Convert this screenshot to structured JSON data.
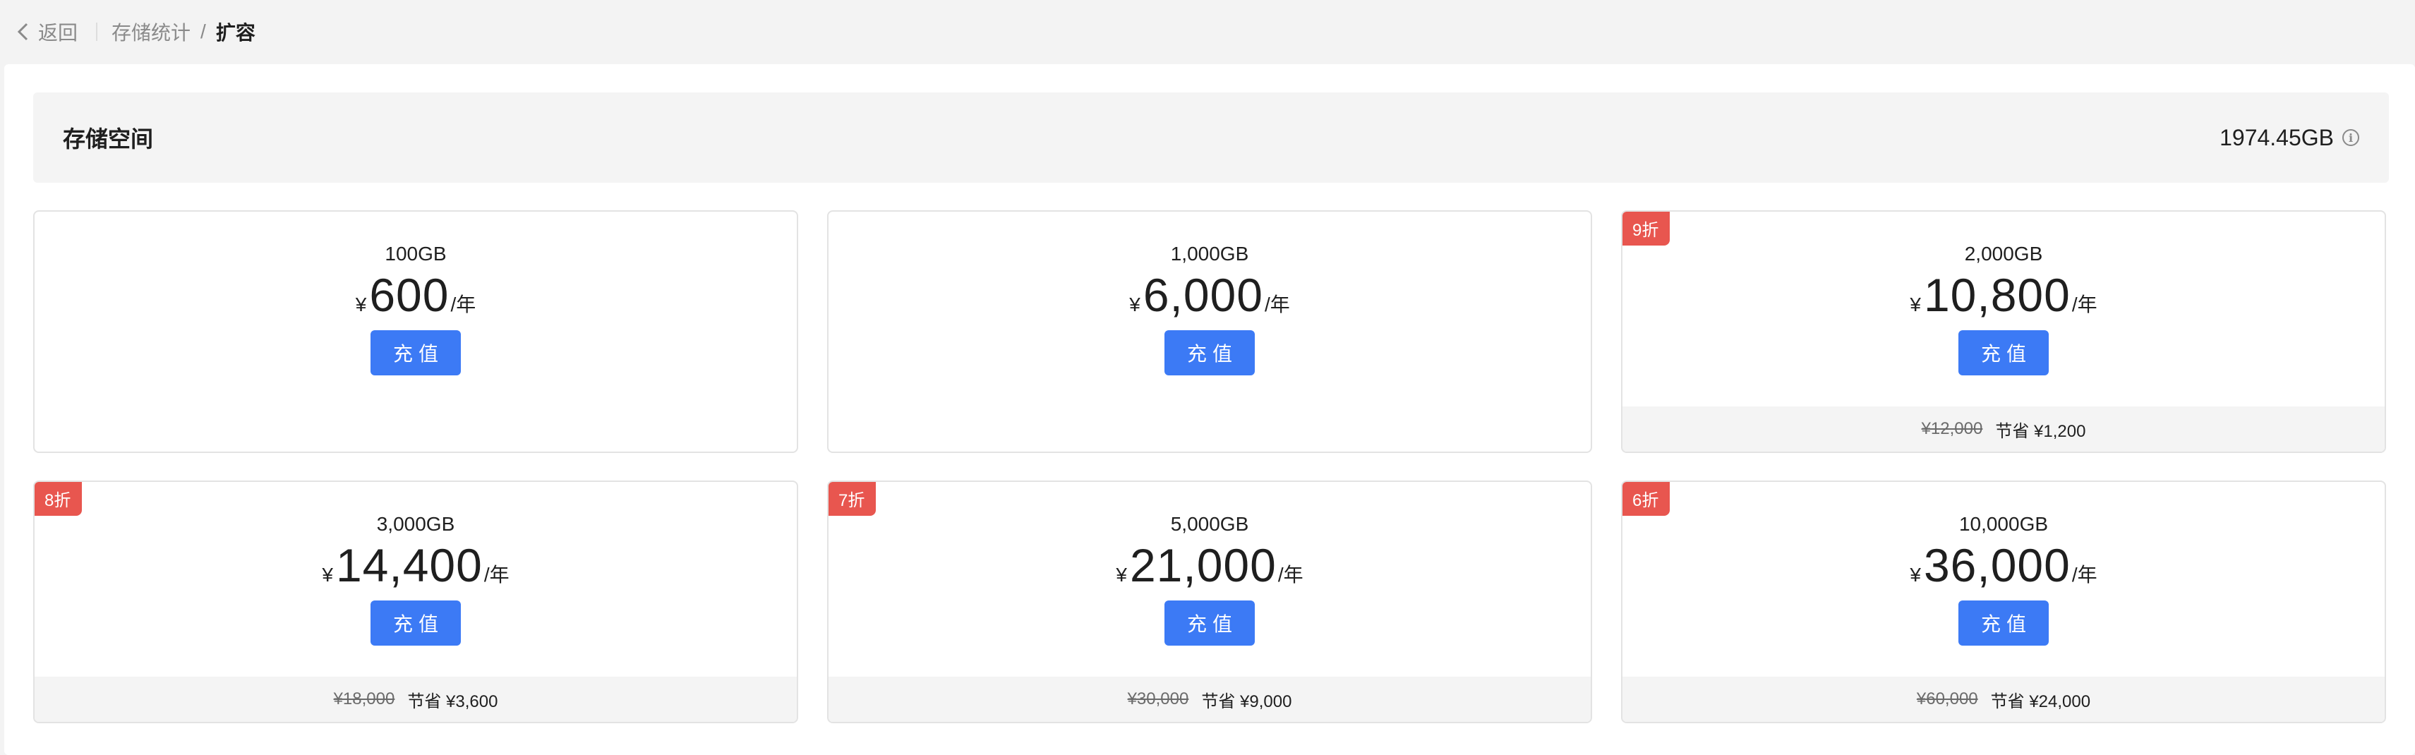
{
  "topbar": {
    "back_label": "返回",
    "breadcrumb": [
      "存储统计",
      "扩容"
    ],
    "separator": "/"
  },
  "storage": {
    "title": "存储空间",
    "value": "1974.45GB"
  },
  "currency": "¥",
  "unit": "/年",
  "button_label": "充值",
  "save_label": "节省",
  "colors": {
    "accent": "#3c7af5",
    "badge": "#e8564f"
  },
  "plans": [
    {
      "capacity": "100GB",
      "price": "600",
      "badge": "",
      "original": "",
      "saving": ""
    },
    {
      "capacity": "1,000GB",
      "price": "6,000",
      "badge": "",
      "original": "",
      "saving": ""
    },
    {
      "capacity": "2,000GB",
      "price": "10,800",
      "badge": "9折",
      "original": "¥12,000",
      "saving": "¥1,200"
    },
    {
      "capacity": "3,000GB",
      "price": "14,400",
      "badge": "8折",
      "original": "¥18,000",
      "saving": "¥3,600"
    },
    {
      "capacity": "5,000GB",
      "price": "21,000",
      "badge": "7折",
      "original": "¥30,000",
      "saving": "¥9,000"
    },
    {
      "capacity": "10,000GB",
      "price": "36,000",
      "badge": "6折",
      "original": "¥60,000",
      "saving": "¥24,000"
    }
  ]
}
